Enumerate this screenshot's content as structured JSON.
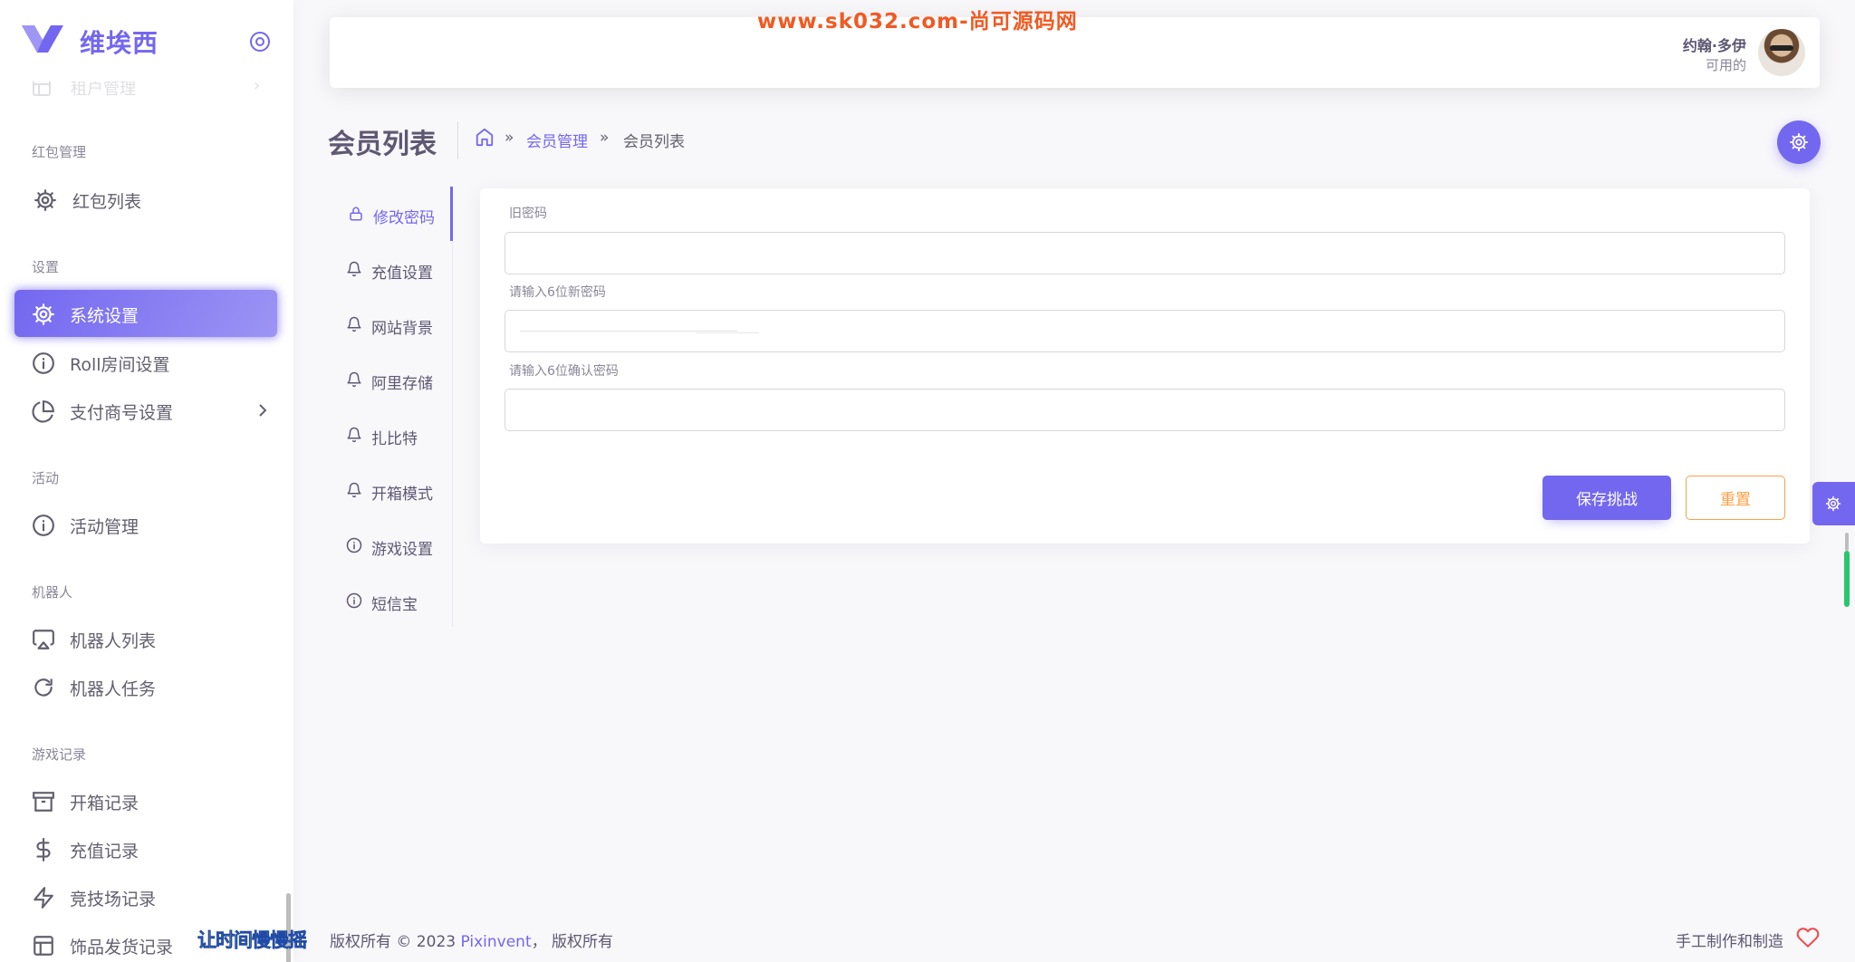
{
  "brand": {
    "name": "维埃西"
  },
  "watermark": "www.sk032.com-尚可源码网",
  "sidebar": {
    "partial_item": {
      "label": "租户管理",
      "icon": "layout-icon"
    },
    "sections": [
      {
        "title": "红包管理",
        "items": [
          {
            "label": "红包列表",
            "icon": "gear-icon"
          }
        ]
      },
      {
        "title": "设置",
        "items": [
          {
            "label": "系统设置",
            "icon": "gear-icon",
            "active": true
          },
          {
            "label": "Roll房间设置",
            "icon": "info-icon"
          },
          {
            "label": "支付商号设置",
            "icon": "pie-chart-icon",
            "has_submenu": true
          }
        ]
      },
      {
        "title": "活动",
        "items": [
          {
            "label": "活动管理",
            "icon": "info-icon"
          }
        ]
      },
      {
        "title": "机器人",
        "items": [
          {
            "label": "机器人列表",
            "icon": "airplay-icon"
          },
          {
            "label": "机器人任务",
            "icon": "refresh-icon"
          }
        ]
      },
      {
        "title": "游戏记录",
        "items": [
          {
            "label": "开箱记录",
            "icon": "archive-icon"
          },
          {
            "label": "充值记录",
            "icon": "dollar-icon"
          },
          {
            "label": "竞技场记录",
            "icon": "zap-icon"
          },
          {
            "label": "饰品发货记录",
            "icon": "layout-icon"
          }
        ]
      }
    ]
  },
  "navbar": {
    "user_name": "约翰·多伊",
    "user_status": "可用的"
  },
  "page": {
    "title": "会员列表",
    "breadcrumb": {
      "link": "会员管理",
      "current": "会员列表",
      "separator": "»"
    }
  },
  "tabs": [
    {
      "label": "修改密码",
      "icon": "lock-icon",
      "active": true
    },
    {
      "label": "充值设置",
      "icon": "bell-icon"
    },
    {
      "label": "网站背景",
      "icon": "bell-icon"
    },
    {
      "label": "阿里存储",
      "icon": "bell-icon"
    },
    {
      "label": "扎比特",
      "icon": "bell-icon"
    },
    {
      "label": "开箱模式",
      "icon": "bell-icon"
    },
    {
      "label": "游戏设置",
      "icon": "info-icon"
    },
    {
      "label": "短信宝",
      "icon": "info-icon"
    }
  ],
  "form": {
    "old_password_label": "旧密码",
    "old_password_value": "",
    "new_password_label": "请输入6位新密码",
    "new_password_value": "",
    "confirm_password_label": "请输入6位确认密码",
    "confirm_password_value": "",
    "save_button": "保存挑战",
    "reset_button": "重置"
  },
  "footer": {
    "overlay_text": "让时间慢慢摇",
    "copyright_prefix": "版权所有 © 2023 ",
    "brand": "Pixinvent",
    "copyright_suffix": "， 版权所有",
    "right_text": "手工制作和制造"
  },
  "colors": {
    "primary": "#7367f0",
    "warning": "#ff9f43",
    "success": "#28c76f",
    "watermark": "#f05a22",
    "heart": "#ea5455"
  }
}
